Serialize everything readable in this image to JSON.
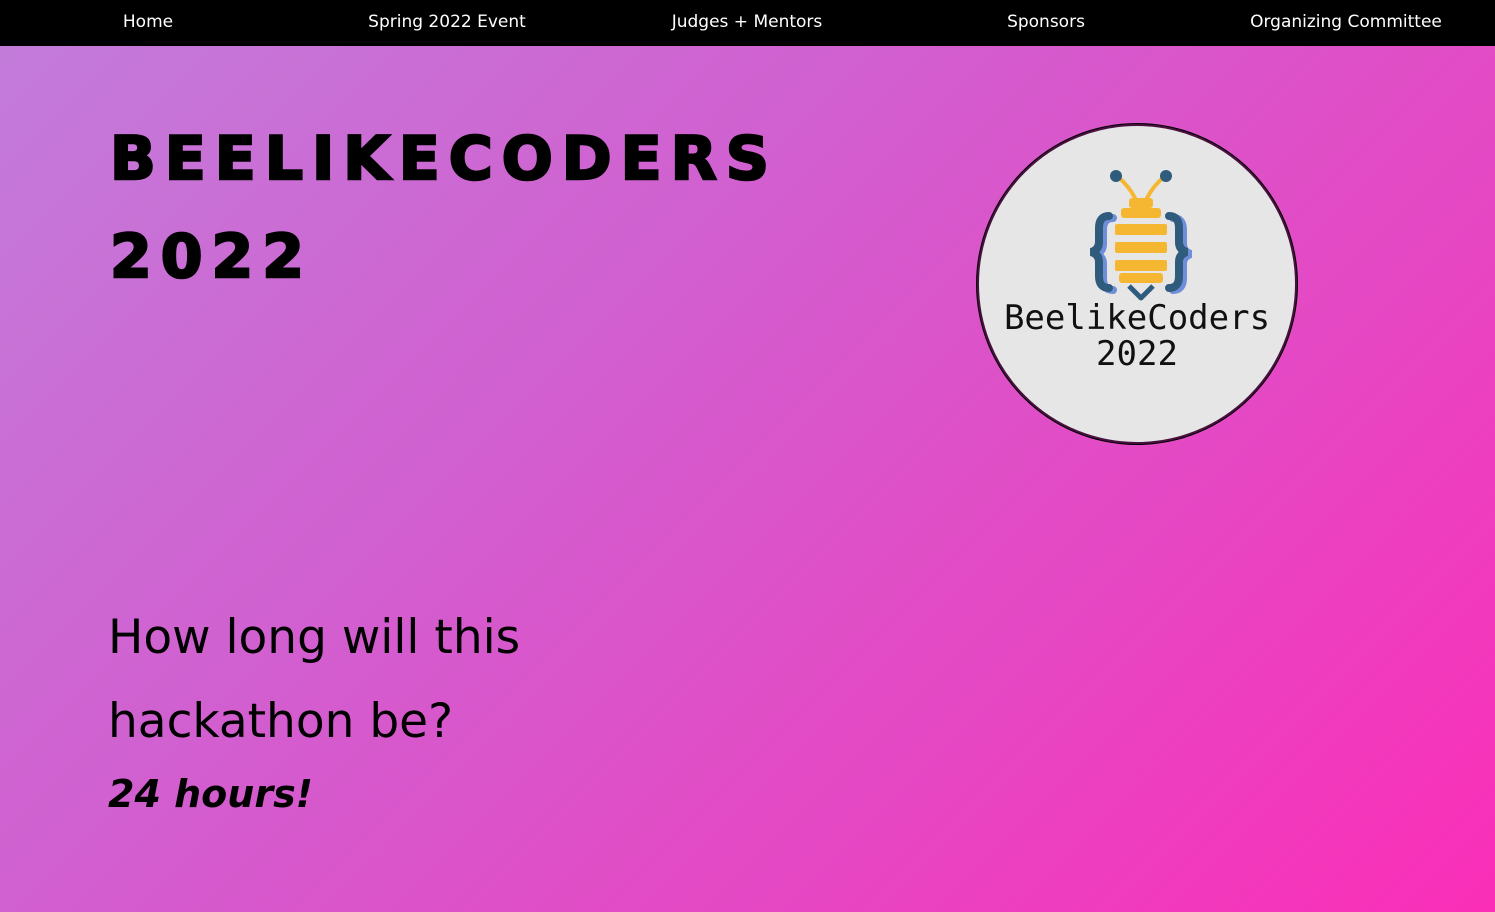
{
  "nav": {
    "items": [
      {
        "label": "Home"
      },
      {
        "label": "Spring 2022 Event"
      },
      {
        "label": "Judges + Mentors"
      },
      {
        "label": "Sponsors"
      },
      {
        "label": "Organizing Committee"
      }
    ]
  },
  "hero": {
    "title_line1": "BEELIKECODERS",
    "title_line2": "2022"
  },
  "logo": {
    "line1": "BeelikeCoders",
    "line2": "2022",
    "icon": "bee-icon",
    "colors": {
      "bee_yellow": "#f5b731",
      "bee_blue": "#2f5b7c",
      "brace_shadow": "#6f8ed8",
      "badge_bg": "#e6e6e6"
    }
  },
  "faq": {
    "question": "How long will this hackathon be?",
    "answer": "24 hours!"
  },
  "theme": {
    "nav_bg": "#000000",
    "gradient_start": "#c27ddb",
    "gradient_end": "#fb2eb8"
  }
}
